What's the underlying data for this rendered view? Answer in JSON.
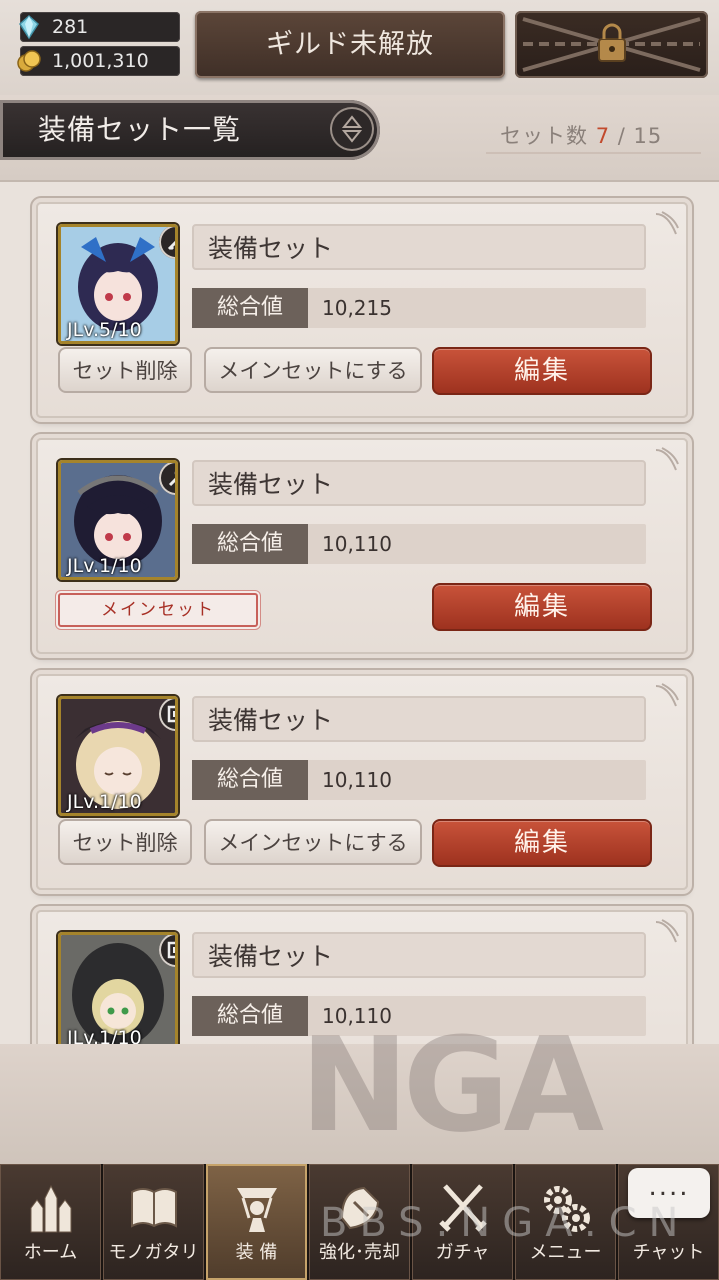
{
  "resources": {
    "crystals": "281",
    "gold": "1,001,310"
  },
  "header": {
    "guild_button": "ギルド未解放",
    "title": "装備セット一覧",
    "set_count_label": "セット数",
    "set_count_current": "7",
    "set_count_sep": "/",
    "set_count_max": "15"
  },
  "sets": [
    {
      "name": "装備セット",
      "power_label": "総合値",
      "power": "10,215",
      "level": "JLv.5/10",
      "is_main": false,
      "delete_label": "セット削除",
      "make_main_label": "メインセットにする",
      "edit_label": "編集"
    },
    {
      "name": "装備セット",
      "power_label": "総合値",
      "power": "10,110",
      "level": "JLv.1/10",
      "is_main": true,
      "main_badge": "メインセット",
      "edit_label": "編集"
    },
    {
      "name": "装備セット",
      "power_label": "総合値",
      "power": "10,110",
      "level": "JLv.1/10",
      "is_main": false,
      "delete_label": "セット削除",
      "make_main_label": "メインセットにする",
      "edit_label": "編集"
    },
    {
      "name": "装備セット",
      "power_label": "総合値",
      "power": "10,110",
      "level": "JLv.1/10"
    }
  ],
  "watermark": {
    "main": "NGA",
    "sub": "BBS.NGA.CN"
  },
  "nav": [
    {
      "label": "ホーム",
      "icon": "castle-icon"
    },
    {
      "label": "モノガタリ",
      "icon": "book-icon"
    },
    {
      "label": "装 備",
      "icon": "equipment-icon",
      "active": true
    },
    {
      "label": "強化･売却",
      "icon": "upgrade-icon"
    },
    {
      "label": "ガチャ",
      "icon": "swords-icon"
    },
    {
      "label": "メニュー",
      "icon": "gears-icon"
    },
    {
      "label": "チャット",
      "icon": "chat-icon"
    }
  ],
  "chat_bubble": "....",
  "colors": {
    "accent_red": "#b2412b",
    "dark_panel": "#2a2626",
    "count_highlight": "#c24a2d"
  }
}
